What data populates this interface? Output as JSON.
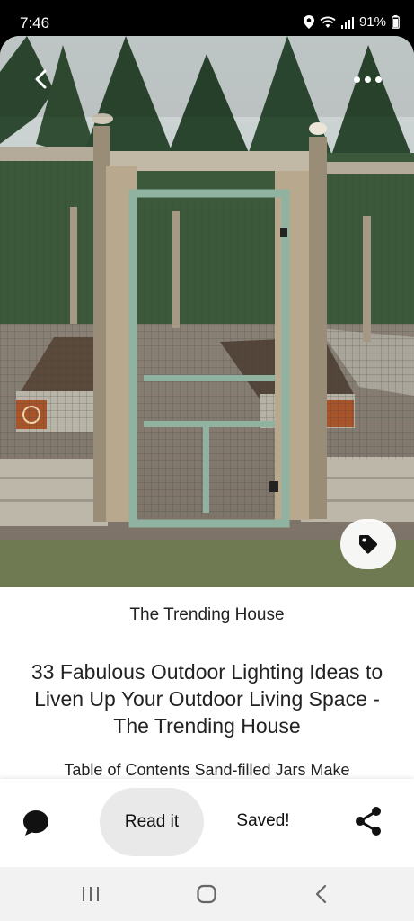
{
  "status_bar": {
    "time": "7:46",
    "battery": "91%",
    "icons": [
      "location-icon",
      "wifi-icon",
      "signal-icon",
      "battery-icon"
    ]
  },
  "pin": {
    "image_icons": {
      "back": "back-arrow-icon",
      "more": "more-options-icon",
      "tag": "tag-icon"
    },
    "source": "The Trending House",
    "title": "33 Fabulous Outdoor Lighting Ideas to Liven Up Your Outdoor Living Space - The Trending House",
    "description": "Table of Contents Sand-filled Jars Make"
  },
  "actions": {
    "comment_icon": "comment-icon",
    "read_label": "Read it",
    "saved_label": "Saved!",
    "share_icon": "share-icon"
  },
  "navigation": {
    "icons": [
      "recents-icon",
      "home-icon",
      "back-icon"
    ]
  }
}
